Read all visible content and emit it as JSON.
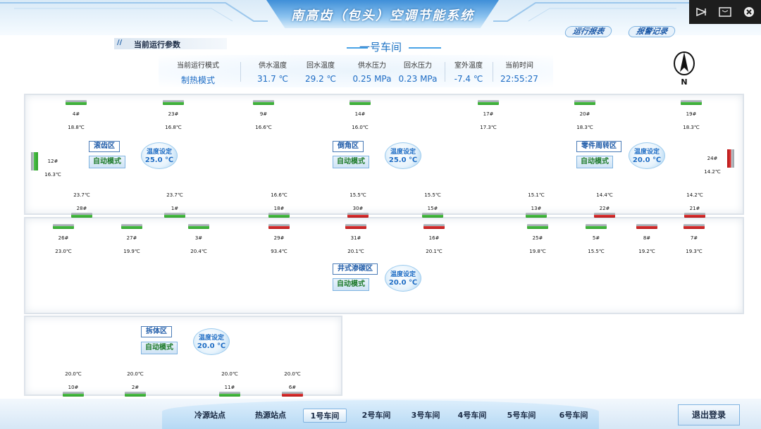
{
  "header": {
    "title": "南高齿（包头）空调节能系统",
    "links": {
      "report": "运行报表",
      "alarm": "报警记录"
    }
  },
  "window_controls": {
    "icons": [
      "collapse-icon",
      "restore-icon",
      "close-icon"
    ]
  },
  "params": {
    "section_label": "当前运行参数",
    "workshop_title": "一号车间",
    "items": [
      {
        "name": "当前运行模式",
        "value": "制热模式"
      },
      {
        "name": "供水温度",
        "value": "31.7  ℃"
      },
      {
        "name": "回水温度",
        "value": "29.2  ℃"
      },
      {
        "name": "供水压力",
        "value": "0.25  MPa"
      },
      {
        "name": "回水压力",
        "value": "0.23  MPa"
      },
      {
        "name": "室外温度",
        "value": "-7.4  ℃"
      },
      {
        "name": "当前时间",
        "value": "22:55:27"
      }
    ]
  },
  "compass": {
    "label": "N"
  },
  "zones": {
    "gunchi": {
      "name": "滚齿区",
      "mode": "自动模式",
      "set_label": "温度设定",
      "set_value": "25.0 ℃"
    },
    "daojiao": {
      "name": "倒角区",
      "mode": "自动模式",
      "set_label": "温度设定",
      "set_value": "25.0 ℃"
    },
    "lingjian": {
      "name": "零件周转区",
      "mode": "自动模式",
      "set_label": "温度设定",
      "set_value": "20.0 ℃"
    },
    "jingshi": {
      "name": "井式渗碳区",
      "mode": "自动模式",
      "set_label": "温度设定",
      "set_value": "20.0 ℃"
    },
    "chaiti": {
      "name": "拆体区",
      "mode": "自动模式",
      "set_label": "温度设定",
      "set_value": "20.0 ℃"
    }
  },
  "units": {
    "top_row": [
      {
        "id": "4#",
        "temp": "18.8℃",
        "status": "green"
      },
      {
        "id": "23#",
        "temp": "16.8℃",
        "status": "green"
      },
      {
        "id": "9#",
        "temp": "16.6℃",
        "status": "green"
      },
      {
        "id": "14#",
        "temp": "16.0℃",
        "status": "green"
      },
      {
        "id": "17#",
        "temp": "17.3℃",
        "status": "green"
      },
      {
        "id": "20#",
        "temp": "18.3℃",
        "status": "green"
      },
      {
        "id": "19#",
        "temp": "18.3℃",
        "status": "green"
      }
    ],
    "side": [
      {
        "id": "12#",
        "temp": "16.3℃",
        "status": "green"
      },
      {
        "id": "24#",
        "temp": "14.2℃",
        "status": "red"
      }
    ],
    "mid_row": [
      {
        "id": "28#",
        "temp": "23.7℃",
        "status": "green"
      },
      {
        "id": "1#",
        "temp": "23.7℃",
        "status": "green"
      },
      {
        "id": "18#",
        "temp": "16.6℃",
        "status": "green"
      },
      {
        "id": "30#",
        "temp": "15.5℃",
        "status": "red"
      },
      {
        "id": "15#",
        "temp": "15.5℃",
        "status": "green"
      },
      {
        "id": "13#",
        "temp": "15.1℃",
        "status": "green"
      },
      {
        "id": "22#",
        "temp": "14.4℃",
        "status": "red"
      },
      {
        "id": "21#",
        "temp": "14.2℃",
        "status": "red"
      }
    ],
    "lower_row": [
      {
        "id": "26#",
        "temp": "23.0℃",
        "status": "green"
      },
      {
        "id": "27#",
        "temp": "19.9℃",
        "status": "green"
      },
      {
        "id": "3#",
        "temp": "20.4℃",
        "status": "green"
      },
      {
        "id": "29#",
        "temp": "93.4℃",
        "status": "red"
      },
      {
        "id": "31#",
        "temp": "20.1℃",
        "status": "red"
      },
      {
        "id": "16#",
        "temp": "20.1℃",
        "status": "red"
      },
      {
        "id": "25#",
        "temp": "19.8℃",
        "status": "green"
      },
      {
        "id": "5#",
        "temp": "15.5℃",
        "status": "green"
      },
      {
        "id": "8#",
        "temp": "19.2℃",
        "status": "red"
      },
      {
        "id": "7#",
        "temp": "19.3℃",
        "status": "red"
      }
    ],
    "bottom_row": [
      {
        "id": "10#",
        "temp": "20.0℃",
        "status": "green"
      },
      {
        "id": "2#",
        "temp": "20.0℃",
        "status": "green"
      },
      {
        "id": "11#",
        "temp": "20.0℃",
        "status": "green"
      },
      {
        "id": "6#",
        "temp": "20.0℃",
        "status": "red"
      }
    ]
  },
  "nav": {
    "tabs": [
      "冷源站点",
      "热源站点",
      "1号车间",
      "2号车间",
      "3号车间",
      "4号车间",
      "5号车间",
      "6号车间"
    ],
    "active": "1号车间",
    "logout": "退出登录"
  },
  "colors": {
    "accent": "#1d6cc4",
    "ac_on": "#2fa02a",
    "ac_alarm": "#d32020"
  }
}
